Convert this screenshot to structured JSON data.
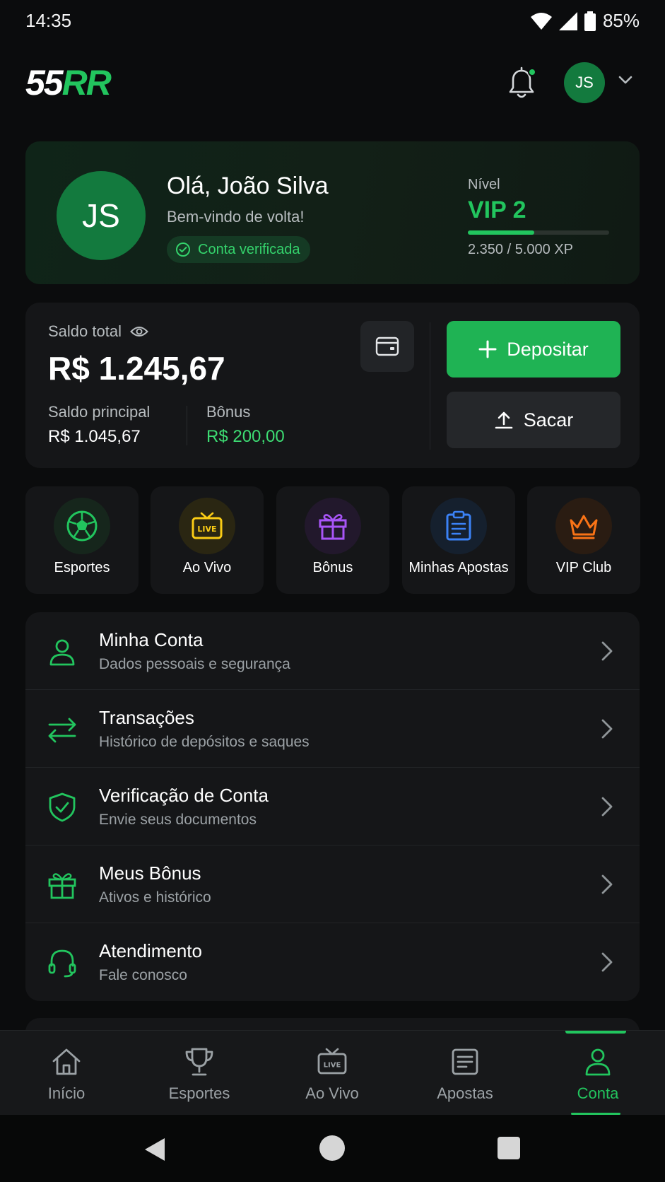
{
  "status_bar": {
    "time": "14:35",
    "battery": "85%"
  },
  "header": {
    "logo_white": "55",
    "logo_green": "RR",
    "avatar_initials": "JS"
  },
  "profile": {
    "initials": "JS",
    "greeting": "Olá, João Silva",
    "subtitle": "Bem-vindo de volta!",
    "verified_label": "Conta verificada",
    "level_label": "Nível",
    "level_value": "VIP 2",
    "xp_text": "2.350 / 5.000 XP",
    "xp_progress": 0.47
  },
  "balance": {
    "total_label": "Saldo total",
    "total_value": "R$ 1.245,67",
    "main_label": "Saldo principal",
    "main_value": "R$ 1.045,67",
    "bonus_label": "Bônus",
    "bonus_value": "R$ 200,00",
    "deposit_label": "Depositar",
    "withdraw_label": "Sacar"
  },
  "quick_actions": [
    {
      "label": "Esportes",
      "icon": "soccer-ball-icon",
      "color": "#22c55e"
    },
    {
      "label": "Ao Vivo",
      "icon": "live-tv-icon",
      "color": "#facc15"
    },
    {
      "label": "Bônus",
      "icon": "gift-icon",
      "color": "#a855f7"
    },
    {
      "label": "Minhas Apostas",
      "icon": "clipboard-icon",
      "color": "#3b82f6"
    },
    {
      "label": "VIP Club",
      "icon": "crown-icon",
      "color": "#f97316"
    }
  ],
  "menu": [
    {
      "title": "Minha Conta",
      "subtitle": "Dados pessoais e segurança",
      "icon": "user-icon"
    },
    {
      "title": "Transações",
      "subtitle": "Histórico de depósitos e saques",
      "icon": "transfer-arrows-icon"
    },
    {
      "title": "Verificação de Conta",
      "subtitle": "Envie seus documentos",
      "icon": "shield-check-icon"
    },
    {
      "title": "Meus Bônus",
      "subtitle": "Ativos e histórico",
      "icon": "gift-icon"
    },
    {
      "title": "Atendimento",
      "subtitle": "Fale conosco",
      "icon": "headset-icon"
    }
  ],
  "bottom_nav": [
    {
      "label": "Início",
      "icon": "home-icon"
    },
    {
      "label": "Esportes",
      "icon": "trophy-icon"
    },
    {
      "label": "Ao Vivo",
      "icon": "live-tv-icon"
    },
    {
      "label": "Apostas",
      "icon": "betslip-icon"
    },
    {
      "label": "Conta",
      "icon": "user-icon",
      "active": true
    }
  ],
  "colors": {
    "accent": "#22c55e",
    "background": "#0b0c0d",
    "card": "#151618"
  }
}
